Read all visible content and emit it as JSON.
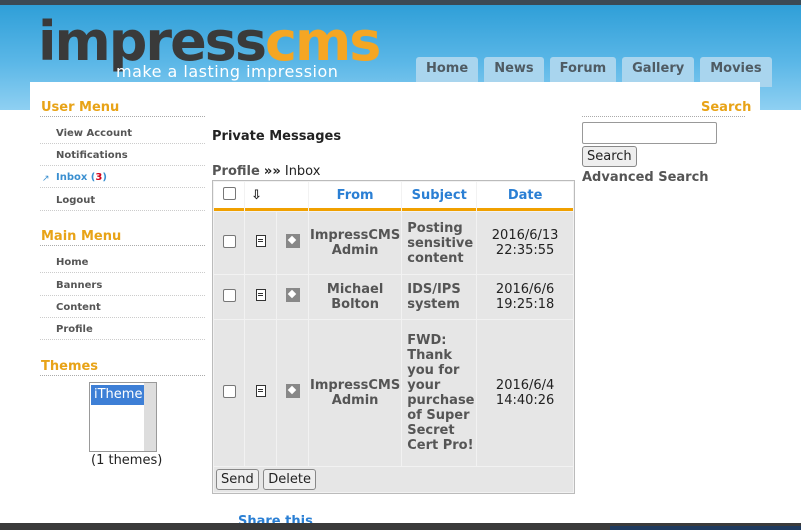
{
  "header": {
    "logo_part1": "impress",
    "logo_part2": "cms",
    "tagline": "make a lasting impression",
    "tabs": [
      "Home",
      "News",
      "Forum",
      "Gallery",
      "Movies"
    ]
  },
  "user_menu": {
    "title": "User Menu",
    "items": [
      "View Account",
      "Notifications",
      "Inbox",
      "Logout"
    ],
    "inbox_count": "3"
  },
  "main_menu": {
    "title": "Main Menu",
    "items": [
      "Home",
      "Banners",
      "Content",
      "Profile"
    ]
  },
  "themes": {
    "title": "Themes",
    "selected": "iTheme",
    "count": "(1 themes)"
  },
  "messages": {
    "title": "Private Messages",
    "breadcrumb_profile": "Profile",
    "breadcrumb_sep": "»»",
    "breadcrumb_current": "Inbox",
    "columns": [
      "From",
      "Subject",
      "Date"
    ],
    "rows": [
      {
        "from": "ImpressCMS Admin",
        "subject": "Posting sensitive content",
        "date": "2016/6/13 22:35:55"
      },
      {
        "from": "Michael Bolton",
        "subject": "IDS/IPS system",
        "date": "2016/6/6 19:25:18"
      },
      {
        "from": "ImpressCMS Admin",
        "subject": "FWD: Thank you for your purchase of Super Secret Cert Pro!",
        "date": "2016/6/4 14:40:26"
      }
    ],
    "send_label": "Send",
    "delete_label": "Delete",
    "share": "Share this"
  },
  "search": {
    "title": "Search",
    "button": "Search",
    "advanced": "Advanced Search"
  },
  "colors": {
    "accent": "#e8a317",
    "link": "#2a7fd4"
  }
}
